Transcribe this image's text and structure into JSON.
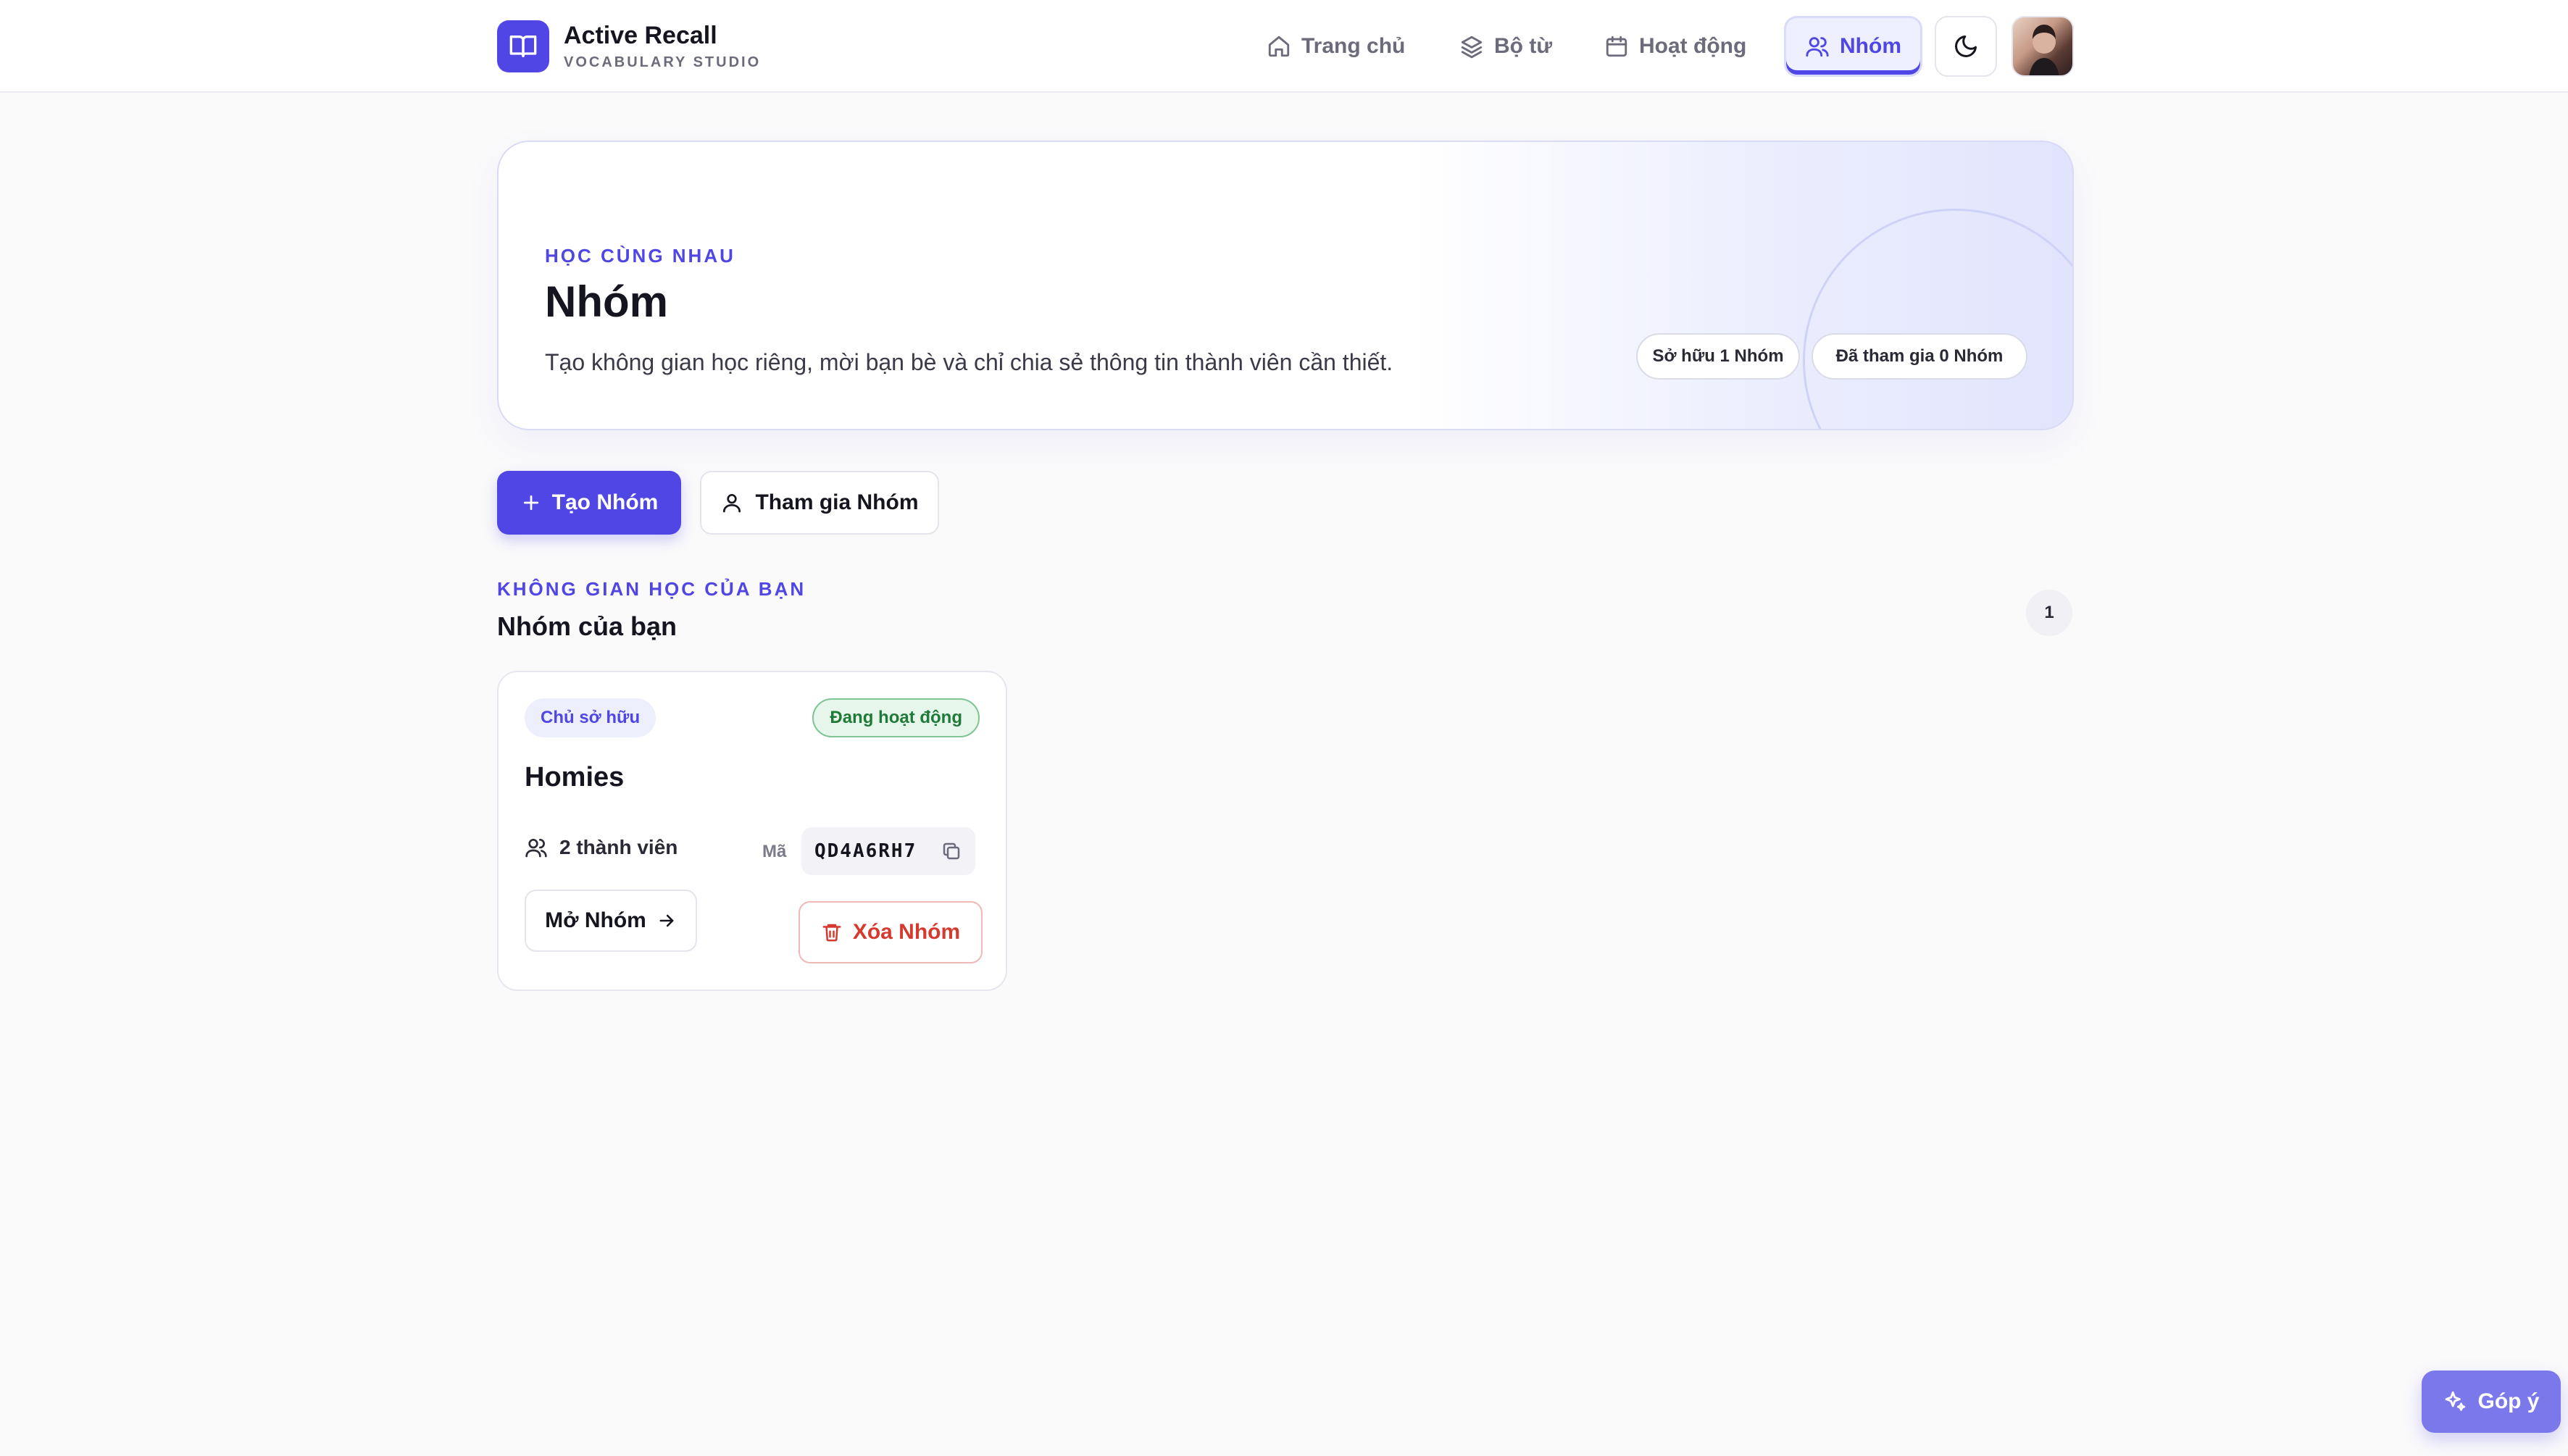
{
  "brand": {
    "title": "Active Recall",
    "subtitle": "VOCABULARY STUDIO"
  },
  "nav": {
    "items": [
      {
        "label": "Trang chủ",
        "icon": "home-icon"
      },
      {
        "label": "Bộ từ",
        "icon": "layers-icon"
      },
      {
        "label": "Hoạt động",
        "icon": "calendar-icon"
      },
      {
        "label": "Nhóm",
        "icon": "users-icon",
        "active": true
      }
    ],
    "theme_icon": "moon-icon"
  },
  "hero": {
    "eyebrow": "HỌC CÙNG NHAU",
    "title": "Nhóm",
    "description": "Tạo không gian học riêng, mời bạn bè và chỉ chia sẻ thông tin thành viên cần thiết.",
    "owned_pill": "Sở hữu 1 Nhóm",
    "joined_pill": "Đã tham gia 0 Nhóm"
  },
  "actions": {
    "create_label": "Tạo Nhóm",
    "join_label": "Tham gia Nhóm"
  },
  "section": {
    "eyebrow": "KHÔNG GIAN HỌC CỦA BẠN",
    "title": "Nhóm của bạn",
    "count": "1"
  },
  "groups": [
    {
      "role": "Chủ sở hữu",
      "status": "Đang hoạt động",
      "name": "Homies",
      "members": "2 thành viên",
      "code_label": "Mã",
      "code": "QD4A6RH7",
      "open_label": "Mở Nhóm",
      "delete_label": "Xóa Nhóm"
    }
  ],
  "feedback": {
    "label": "Góp ý"
  },
  "colors": {
    "accent": "#4f46e5",
    "danger": "#d63a2f",
    "success": "#1f7a3a"
  }
}
